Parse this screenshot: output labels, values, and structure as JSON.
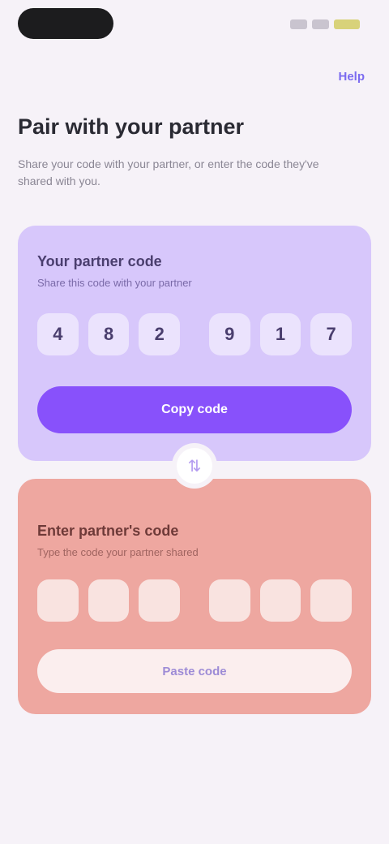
{
  "help": {
    "label": "Help"
  },
  "header": {
    "title": "Pair with your partner",
    "subtitle": "Share your code with your partner, or enter the code they've shared with you."
  },
  "share_card": {
    "title": "Your partner code",
    "subtitle": "Share this code with your partner",
    "code": [
      "4",
      "8",
      "2",
      "9",
      "1",
      "7"
    ],
    "button_label": "Copy code"
  },
  "swap": {
    "icon": "swap-arrows-icon",
    "glyph": "⇅"
  },
  "enter_card": {
    "title": "Enter partner's code",
    "subtitle": "Type the code your partner shared",
    "code": [
      "",
      "",
      "",
      "",
      "",
      ""
    ],
    "button_label": "Paste code"
  },
  "colors": {
    "accent": "#8851fb",
    "share_card": "#d7c7fb",
    "enter_card": "#eea7a0",
    "background": "#f6f2f8"
  }
}
